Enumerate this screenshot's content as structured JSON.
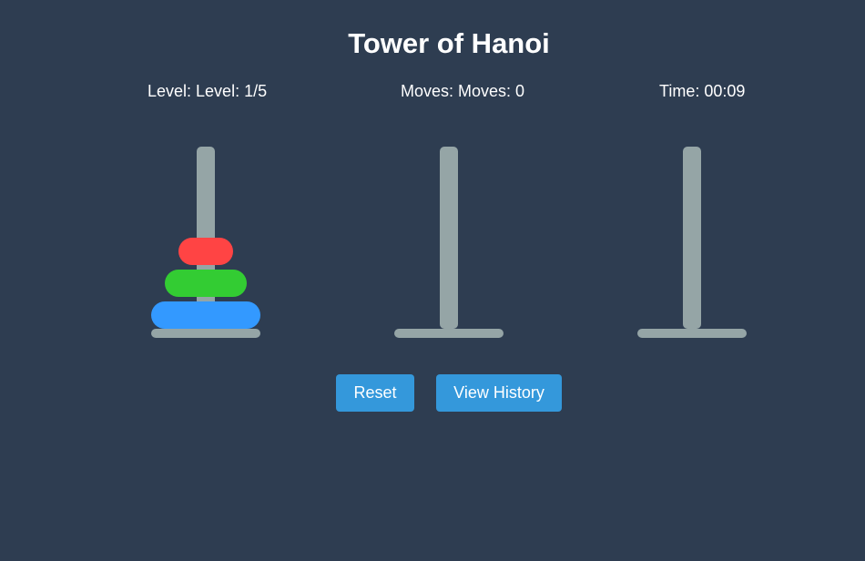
{
  "title": "Tower of Hanoi",
  "stats": {
    "level": "Level: Level: 1/5",
    "moves": "Moves: Moves: 0",
    "time": "Time: 00:09"
  },
  "buttons": {
    "reset": "Reset",
    "history": "View History"
  },
  "game": {
    "peg_color": "#95a5a6",
    "towers": [
      {
        "disks": [
          {
            "size": 3,
            "color": "#3399ff"
          },
          {
            "size": 2,
            "color": "#33cc33"
          },
          {
            "size": 1,
            "color": "#ff4444"
          }
        ]
      },
      {
        "disks": []
      },
      {
        "disks": []
      }
    ]
  }
}
